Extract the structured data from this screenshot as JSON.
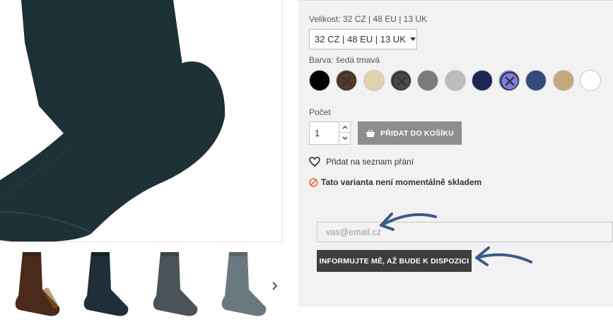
{
  "size": {
    "label": "Velikost:",
    "current": "32 CZ | 48 EU | 13 UK",
    "selected": "32 CZ | 48 EU | 13 UK"
  },
  "color": {
    "label": "Barva:",
    "current": "šedá tmavá",
    "swatches": [
      {
        "name": "black",
        "hex": "#000000",
        "unavailable": false
      },
      {
        "name": "brown",
        "hex": "#5a3a26",
        "unavailable": true
      },
      {
        "name": "beige",
        "hex": "#e0d2b0",
        "unavailable": false
      },
      {
        "name": "dark-grey",
        "hex": "#4a4a4a",
        "unavailable": true
      },
      {
        "name": "grey",
        "hex": "#7a7a7a",
        "unavailable": false
      },
      {
        "name": "light-grey",
        "hex": "#bcbcbc",
        "unavailable": false
      },
      {
        "name": "navy",
        "hex": "#1e2552",
        "unavailable": false
      },
      {
        "name": "blue-violet",
        "hex": "#7e7ee8",
        "unavailable": true
      },
      {
        "name": "steel-blue",
        "hex": "#334a7d",
        "unavailable": false
      },
      {
        "name": "tan",
        "hex": "#c8a67d",
        "unavailable": false
      },
      {
        "name": "white",
        "hex": "#ffffff",
        "unavailable": false
      }
    ]
  },
  "quantity": {
    "label": "Počet",
    "value": "1"
  },
  "cart": {
    "add_label": "PŘIDAT DO KOŠÍKU"
  },
  "wishlist": {
    "label": "Přidat na seznam přání"
  },
  "stock": {
    "message": "Tato varianta není momentálně skladem",
    "status_color": "#e8692c"
  },
  "notify": {
    "email_placeholder": "vas@email.cz",
    "button_label": "INFORMUJTE MĚ, AŽ BUDE K DISPOZICI"
  },
  "gallery": {
    "thumbnails": [
      {
        "color": "#4a2a1a"
      },
      {
        "color": "#1f2e38"
      },
      {
        "color": "#4a5458"
      },
      {
        "color": "#6a7880"
      }
    ]
  },
  "colors": {
    "panel_bg": "#f2f2f2",
    "sock_main": "#1d3238",
    "button_disabled": "#8e8e8e",
    "button_dark": "#3e3e3e",
    "annotation_arrow": "#3a5a8a"
  }
}
